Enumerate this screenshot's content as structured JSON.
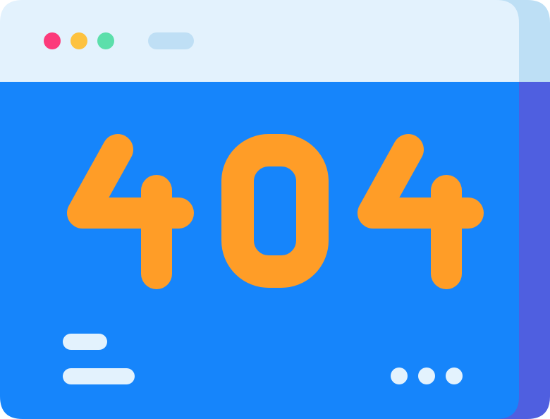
{
  "illustration": {
    "error_code": "404",
    "window_dots": [
      "close-dot",
      "minimize-dot",
      "maximize-dot"
    ],
    "colors": {
      "frame_back_top": "#bddff5",
      "frame_back_body": "#4f5fe0",
      "title_bar": "#e3f2fd",
      "body": "#1685fb",
      "digits": "#ff9d27",
      "dot_red": "#fc3b7b",
      "dot_yellow": "#fdc23f",
      "dot_green": "#5cdfab",
      "address_pill": "#bfdff5",
      "text_lines": "#e3f2fd",
      "menu_dots": "#e3f2fd"
    }
  }
}
